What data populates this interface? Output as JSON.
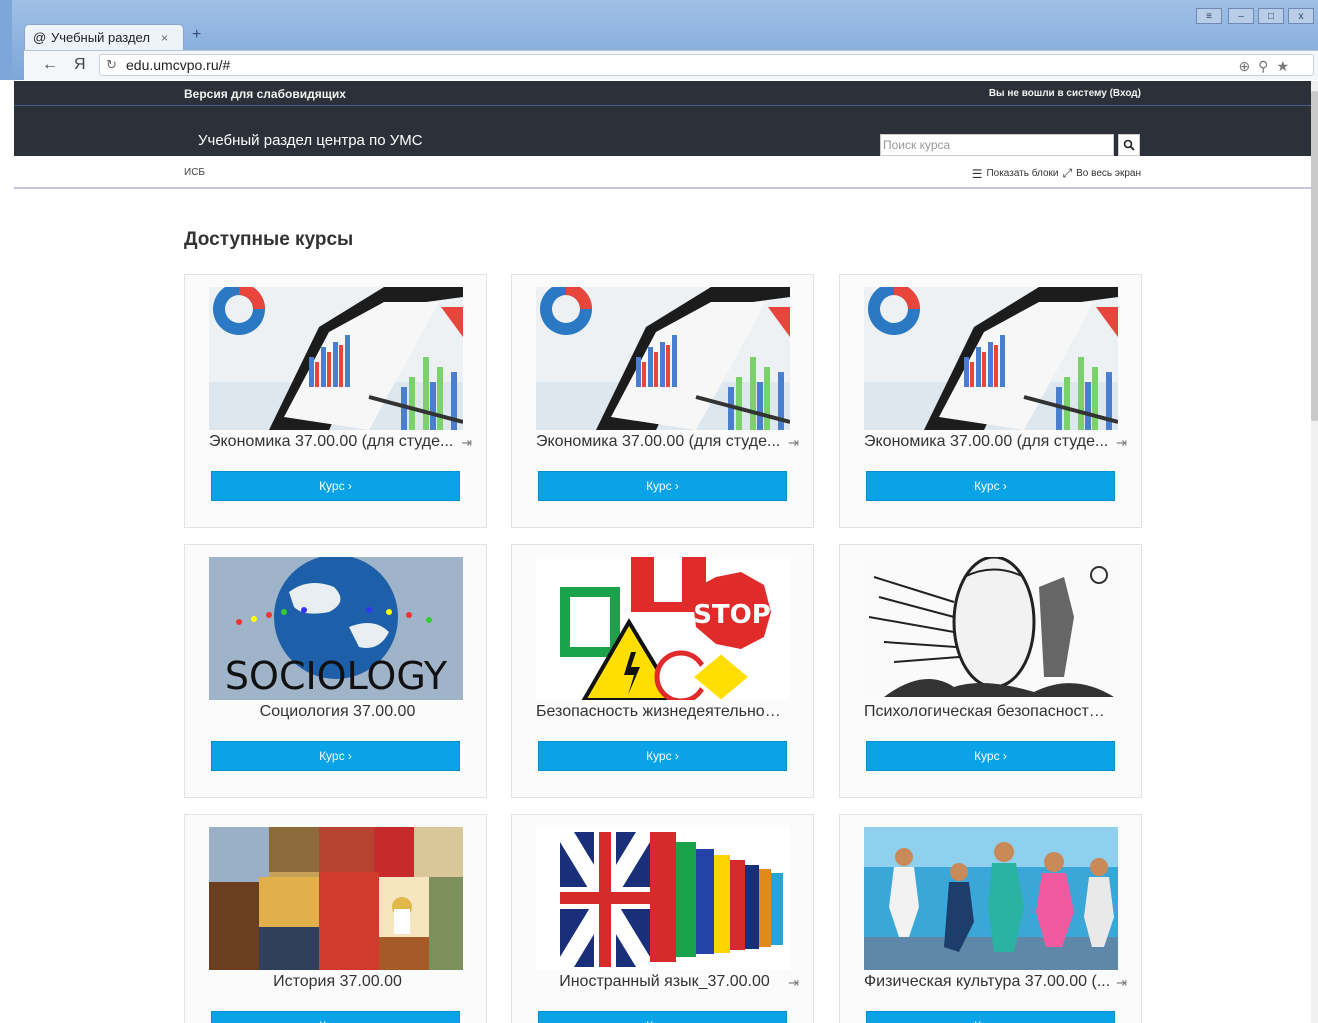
{
  "browser": {
    "tab_title": "Учебный раздел",
    "tab_close": "×",
    "new_tab": "+",
    "url": "edu.umcvpo.ru/#",
    "back": "←",
    "yandex": "Я"
  },
  "site": {
    "accessibility_link": "Версия для слабовидящих",
    "login_status": "Вы не вошли в систему (Вход)",
    "name": "Учебный раздел центра по УМС",
    "search_placeholder": "Поиск курса",
    "breadcrumb": "ИСБ",
    "show_blocks": "Показать блоки",
    "fullscreen": "Во весь экран"
  },
  "main": {
    "heading": "Доступные курсы",
    "button_label": "Курс ›",
    "courses": [
      {
        "title": "Экономика 37.00.00 (для студе...",
        "image": "economics-chart",
        "enrol_icon": true
      },
      {
        "title": "Экономика 37.00.00 (для студе...",
        "image": "economics-chart",
        "enrol_icon": true
      },
      {
        "title": "Экономика 37.00.00 (для студе...",
        "image": "economics-chart",
        "enrol_icon": true
      },
      {
        "title": "Социология 37.00.00",
        "image": "sociology-globe",
        "enrol_icon": false,
        "image_text": "SOCIOLOGY"
      },
      {
        "title": "Безопасность жизнедеятельнос...",
        "image": "safety-signs",
        "enrol_icon": false,
        "image_text": "STOP"
      },
      {
        "title": "Психологическая безопасность ...",
        "image": "psychology-drawing",
        "enrol_icon": false
      },
      {
        "title": "История 37.00.00",
        "image": "history-collage",
        "enrol_icon": false
      },
      {
        "title": "Иностранный язык_37.00.00",
        "image": "flag-books",
        "enrol_icon": true
      },
      {
        "title": "Физическая культура 37.00.00 (...",
        "image": "fitness-class",
        "enrol_icon": true
      }
    ]
  }
}
